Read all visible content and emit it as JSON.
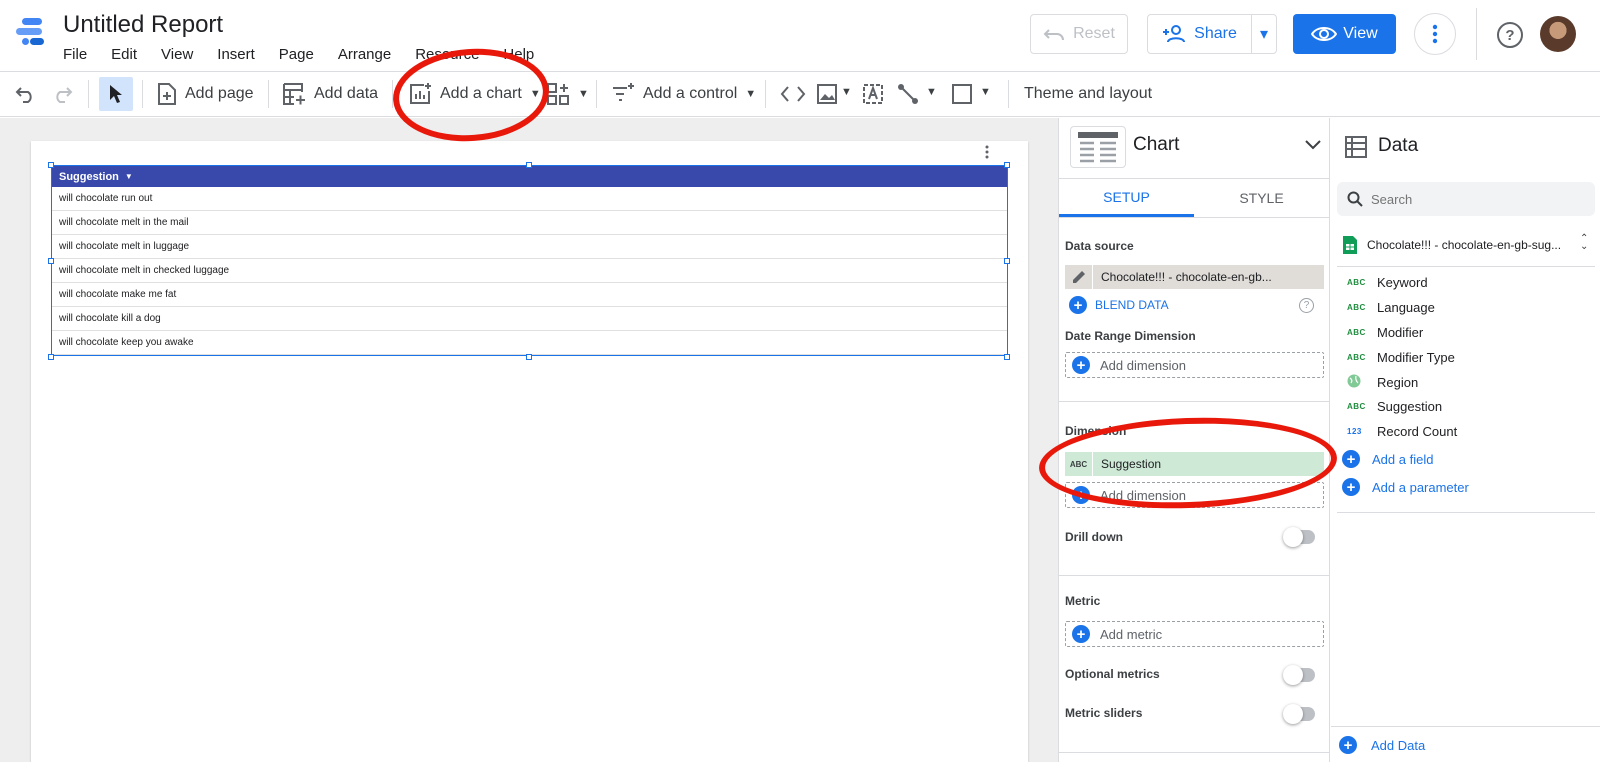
{
  "app": {
    "title": "Untitled Report",
    "menu": [
      "File",
      "Edit",
      "View",
      "Insert",
      "Page",
      "Arrange",
      "Resource",
      "Help"
    ],
    "reset_label": "Reset",
    "share_label": "Share",
    "view_label": "View"
  },
  "toolbar": {
    "add_page": "Add page",
    "add_data": "Add data",
    "add_chart": "Add a chart",
    "add_control": "Add a control",
    "theme": "Theme and layout"
  },
  "table": {
    "header": "Suggestion",
    "rows": [
      "will chocolate run out",
      "will chocolate melt in the mail",
      "will chocolate melt in luggage",
      "will chocolate melt in checked luggage",
      "will chocolate make me fat",
      "will chocolate kill a dog",
      "will chocolate keep you awake"
    ]
  },
  "chart_panel": {
    "title": "Chart",
    "tabs": [
      "SETUP",
      "STYLE"
    ],
    "data_source_label": "Data source",
    "data_source_value": "Chocolate!!! - chocolate-en-gb...",
    "blend_data": "BLEND DATA",
    "date_range_label": "Date Range Dimension",
    "add_dimension": "Add dimension",
    "dimension_label": "Dimension",
    "dimension_value": "Suggestion",
    "drill_down": "Drill down",
    "metric_label": "Metric",
    "add_metric": "Add metric",
    "optional_metrics": "Optional metrics",
    "metric_sliders": "Metric sliders"
  },
  "data_panel": {
    "title": "Data",
    "search_placeholder": "Search",
    "source_name": "Chocolate!!! - chocolate-en-gb-sug...",
    "fields": [
      {
        "type": "ABC",
        "name": "Keyword"
      },
      {
        "type": "ABC",
        "name": "Language"
      },
      {
        "type": "ABC",
        "name": "Modifier"
      },
      {
        "type": "ABC",
        "name": "Modifier Type"
      },
      {
        "type": "globe",
        "name": "Region"
      },
      {
        "type": "ABC",
        "name": "Suggestion"
      },
      {
        "type": "123",
        "name": "Record Count"
      }
    ],
    "add_field": "Add a field",
    "add_parameter": "Add a parameter",
    "add_data": "Add Data"
  },
  "colors": {
    "accent": "#1a73e8",
    "table_header": "#3949ab",
    "annotation": "#e8190b",
    "dimension_chip": "#ceead6"
  }
}
